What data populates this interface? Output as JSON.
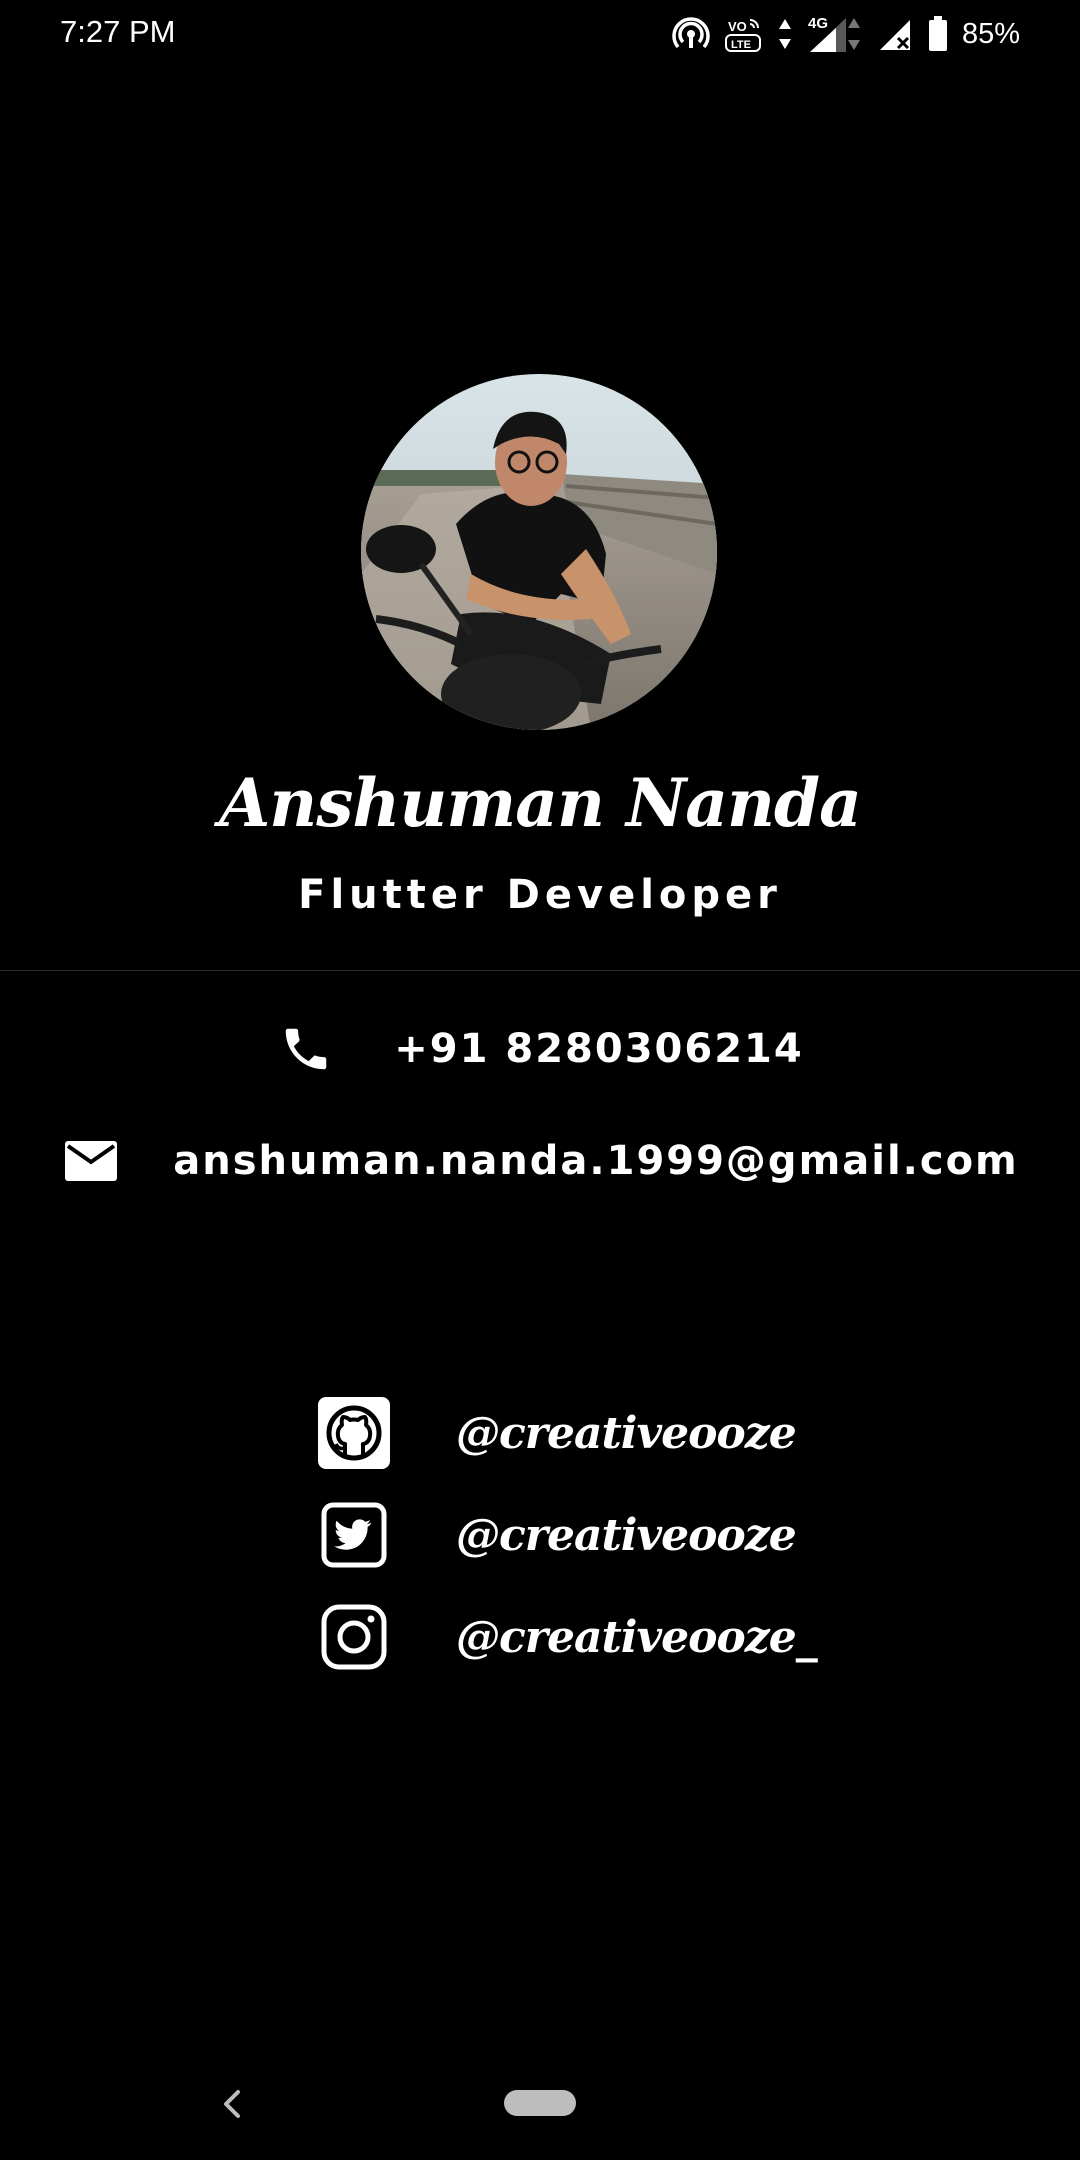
{
  "status_bar": {
    "time": "7:27 PM",
    "network_type": "4G",
    "volte": "VO LTE",
    "battery_percent": "85%",
    "battery_level": 0.85
  },
  "profile": {
    "name": "Anshuman Nanda",
    "title": "Flutter Developer",
    "avatar": "profile-photo"
  },
  "contacts": {
    "phone": {
      "icon": "phone-icon",
      "value": "+91 8280306214"
    },
    "email": {
      "icon": "mail-icon",
      "value": "anshuman.nanda.1999@gmail.com"
    }
  },
  "socials": [
    {
      "icon": "github-icon",
      "handle": "@creativeooze"
    },
    {
      "icon": "twitter-icon",
      "handle": "@creativeooze"
    },
    {
      "icon": "instagram-icon",
      "handle": "@creativeooze_"
    }
  ],
  "nav": {
    "back": "back-icon",
    "home": "home-pill"
  },
  "colors": {
    "background": "#000000",
    "text": "#ffffff",
    "divider": "#2a2a2a",
    "home_pill": "#bdbdbd"
  }
}
